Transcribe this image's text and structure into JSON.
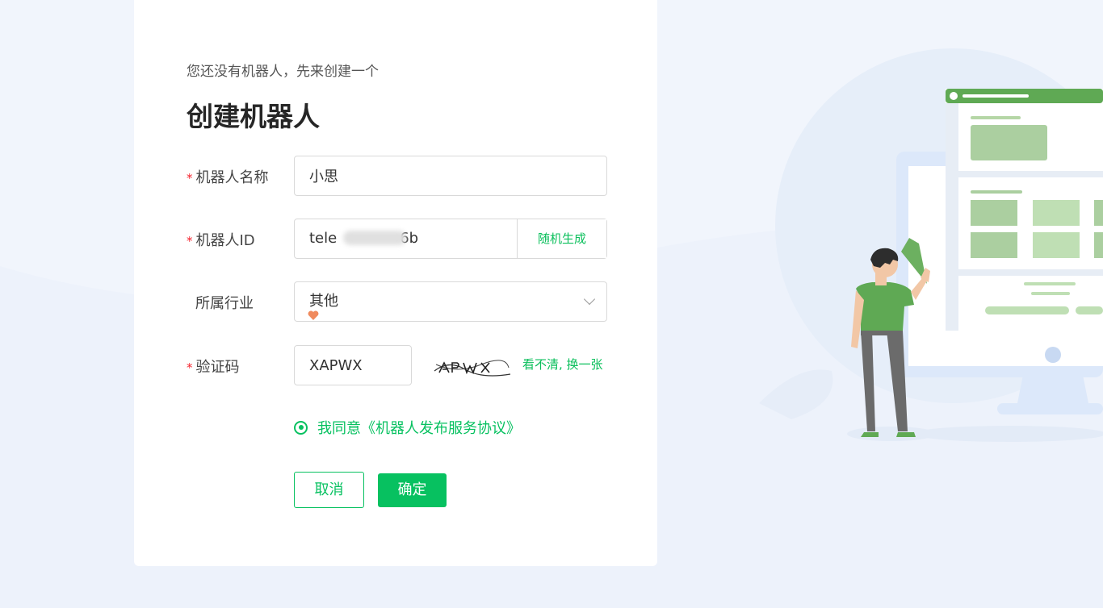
{
  "colors": {
    "accent": "#07c160",
    "required": "#f5222d",
    "page_bg": "#f1f5fc",
    "card_bg": "#ffffff"
  },
  "form": {
    "subtitle": "您还没有机器人，先来创建一个",
    "title": "创建机器人",
    "fields": {
      "name": {
        "label": "机器人名称",
        "required": "*",
        "value": "小思"
      },
      "bot_id": {
        "label": "机器人ID",
        "required": "*",
        "value": "tele",
        "value_suffix": "6b",
        "generate_label": "随机生成"
      },
      "industry": {
        "label": "所属行业",
        "value": "其他"
      },
      "captcha": {
        "label": "验证码",
        "required": "*",
        "value": "XAPWX",
        "refresh_label": "看不清, 换一张"
      }
    },
    "agreement": {
      "text": "我同意《机器人发布服务协议》",
      "checked": true
    },
    "buttons": {
      "cancel": "取消",
      "confirm": "确定"
    }
  },
  "icons": {
    "industry_dropdown": "chevron-down-icon",
    "cursor_heart": "heart-icon",
    "agreement_radio": "radio-checked-icon"
  }
}
